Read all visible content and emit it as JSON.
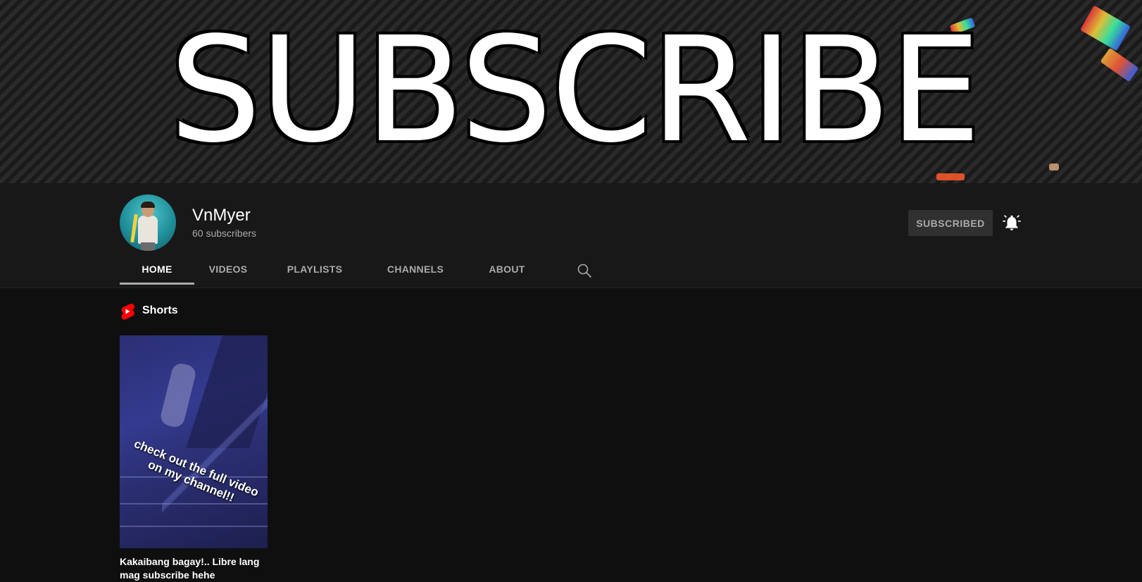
{
  "banner": {
    "text": "SUBSCRIBE"
  },
  "channel": {
    "name": "VnMyer",
    "subscribers": "60 subscribers",
    "subscribe_button": "SUBSCRIBED",
    "bell_icon": "bell-active-icon"
  },
  "tabs": [
    {
      "label": "HOME",
      "active": true
    },
    {
      "label": "VIDEOS",
      "active": false
    },
    {
      "label": "PLAYLISTS",
      "active": false
    },
    {
      "label": "CHANNELS",
      "active": false
    },
    {
      "label": "ABOUT",
      "active": false
    }
  ],
  "tab_search_icon": "search-icon",
  "shorts": {
    "section_title": "Shorts",
    "icon": "shorts-icon",
    "items": [
      {
        "thumbnail_text": "check out the full video on my channel!!",
        "title": "Kakaibang bagay!.. Libre lang mag subscribe hehe"
      }
    ]
  },
  "colors": {
    "background": "#0f0f0f",
    "header": "#181818",
    "accent_red": "#ff0000",
    "muted_text": "#aaaaaa"
  }
}
